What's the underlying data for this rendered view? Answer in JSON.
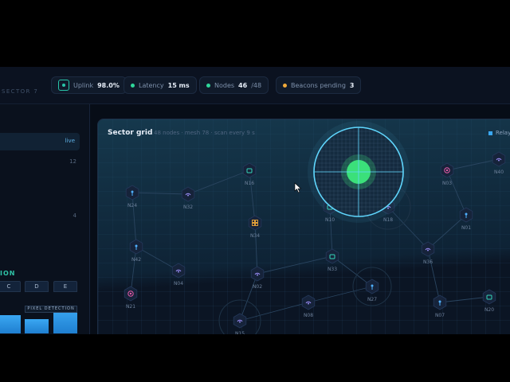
{
  "topbar": {
    "sector_label": "SECTOR 7",
    "uplink": {
      "label": "Uplink",
      "value": "98.0%",
      "icon": "uplink-icon"
    },
    "latency": {
      "label": "Latency",
      "value": "15 ms",
      "dot_color": "#2fd79a"
    },
    "nodes": {
      "label": "Nodes",
      "value": "46",
      "total": "/48",
      "dot_color": "#2fd79a"
    },
    "beacons": {
      "label": "Beacons pending",
      "value": "3",
      "dot_color": "#f0a93a"
    }
  },
  "left_panel": {
    "live_label": "live",
    "scale_top": "12",
    "scale_mid": "4",
    "section_label": "ION",
    "bars": [
      {
        "label": "C",
        "level": 0.45
      },
      {
        "label": "D",
        "level": 0.34
      },
      {
        "label": "E",
        "level": 0.62
      }
    ],
    "pixel_tag": "PIXEL DETECTION"
  },
  "sector_grid": {
    "title": "Sector grid",
    "subtitle": "48 nodes · mesh 78 · scan every 9 s",
    "legend_relay": "Relay",
    "nodes": [
      {
        "id": "N24",
        "type": "relay"
      },
      {
        "id": "N32",
        "type": "sensor"
      },
      {
        "id": "N16",
        "type": "cache"
      },
      {
        "id": "N34",
        "type": "grid"
      },
      {
        "id": "N10",
        "type": "cache"
      },
      {
        "id": "N18",
        "type": "sensor"
      },
      {
        "id": "N03",
        "type": "beacon"
      },
      {
        "id": "N40",
        "type": "sensor"
      },
      {
        "id": "N01",
        "type": "relay"
      },
      {
        "id": "N42",
        "type": "relay"
      },
      {
        "id": "N04",
        "type": "sensor"
      },
      {
        "id": "N21",
        "type": "beacon"
      },
      {
        "id": "N02",
        "type": "sensor"
      },
      {
        "id": "N33",
        "type": "cache"
      },
      {
        "id": "N36",
        "type": "sensor"
      },
      {
        "id": "N27",
        "type": "relay"
      },
      {
        "id": "N08",
        "type": "sensor"
      },
      {
        "id": "N07",
        "type": "relay"
      },
      {
        "id": "N20",
        "type": "cache"
      },
      {
        "id": "N15",
        "type": "sensor"
      }
    ],
    "colors": {
      "relay": "#4fb0ff",
      "sensor": "#9b8cf7",
      "cache": "#34d4b8",
      "grid": "#f0a93a",
      "beacon": "#e85aa8",
      "scan_green": "#3be07a",
      "scan_ring": "#5fd8ff"
    }
  }
}
